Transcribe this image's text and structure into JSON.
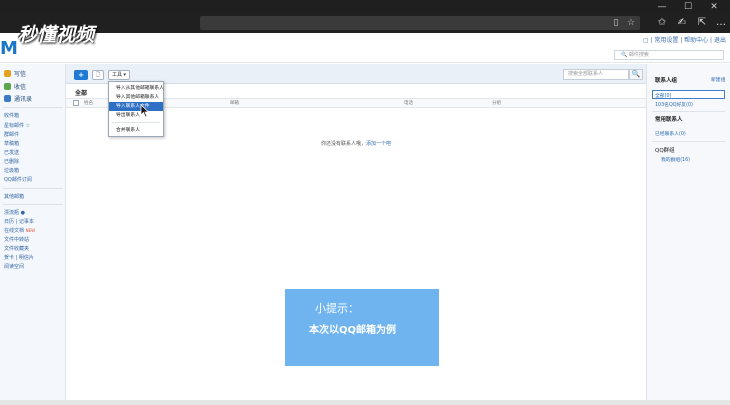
{
  "browser": {
    "window_min": "—",
    "window_max": "☐",
    "window_close": "✕",
    "addr_icons": [
      "▯",
      "☆"
    ],
    "tb_icons": [
      "✩",
      "✍",
      "⇱",
      "…"
    ]
  },
  "watermark": "秒懂视频",
  "app": {
    "logo": "M",
    "top_links": "▢ | 常用设置 | 帮助中心 | 退出",
    "top_search_placeholder": "🔍 邮件搜索"
  },
  "sidebar": {
    "top_items": [
      {
        "label": "写信",
        "color": "#e6a21f"
      },
      {
        "label": "收信",
        "color": "#5aa64b"
      },
      {
        "label": "通讯录",
        "color": "#3c7cc4"
      }
    ],
    "folders": [
      "收件箱",
      "星标邮件 ☆",
      "群邮件",
      "草稿箱",
      "已发送",
      "已删除",
      "垃圾箱",
      "QQ邮件订阅"
    ],
    "folders2": [
      "其他邮箱"
    ],
    "apps": [
      "漂流瓶 ●",
      "日历 | 记事本",
      "文件中转站",
      "贺卡 | 明信片",
      "阅读空间"
    ],
    "apps_extra": [
      {
        "label": "在线文档",
        "hot": "NEW"
      },
      {
        "label": "文件收藏夹"
      }
    ]
  },
  "toolbar": {
    "add_button": "+",
    "delete_button": "🗋",
    "tools_button": "工具 ▾",
    "search_placeholder": "搜索全部联系人",
    "search_button": "🔍"
  },
  "list": {
    "title": "全部",
    "columns": [
      "姓名",
      "邮箱",
      "电话",
      "分组"
    ],
    "empty_text": "你还没有联系人哦，",
    "empty_link": "添加一个吧"
  },
  "dropdown": {
    "items": [
      "导入从其他邮箱联系人",
      "导入其他邮箱联系人",
      "导入联系人文件",
      "导出联系人"
    ],
    "active_index": 2,
    "items2": [
      "合并联系人"
    ]
  },
  "rpanel": {
    "section1_title": "联系人组",
    "section1_link": "新建组",
    "all": "全部(0)",
    "qq_friends": "103名QQ好友(0)",
    "section2_title": "常用联系人",
    "recent": "已经联系人(0)",
    "group_title": "QQ群组",
    "group_item": "我的群组(16)"
  },
  "tip": {
    "title": "小提示：",
    "body": "本次以QQ邮箱为例"
  }
}
